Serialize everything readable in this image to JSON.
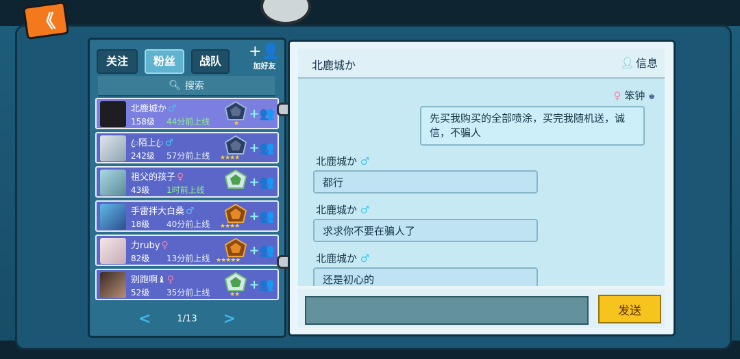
{
  "nav": {
    "back_symbol": "《"
  },
  "tabs": [
    {
      "label": "关注"
    },
    {
      "label": "粉丝"
    },
    {
      "label": "战队"
    }
  ],
  "add_friend": {
    "label": "加好友"
  },
  "search": {
    "placeholder": "搜索"
  },
  "friends": [
    {
      "name": "北鹿城か",
      "gender": "♂",
      "level": "158级",
      "online": "44分前上线",
      "stars": "★"
    },
    {
      "name": "ꦿ陌上ꦿ",
      "gender": "♂",
      "level": "242级",
      "online": "57分前上线",
      "stars": "★★★★"
    },
    {
      "name": "祖父的孩子",
      "gender": "♀",
      "level": "43级",
      "online": "1时前上线",
      "stars": ""
    },
    {
      "name": "手雷拌大白桑",
      "gender": "♂",
      "level": "18级",
      "online": "40分前上线",
      "stars": "★★★★"
    },
    {
      "name": "力ruby",
      "gender": "♀",
      "level": "82级",
      "online": "13分前上线",
      "stars": "★★★★★"
    },
    {
      "name": "别跑啊♝",
      "gender": "♀",
      "level": "52级",
      "online": "35分前上线",
      "stars": "★★"
    }
  ],
  "pager": {
    "text": "1/13"
  },
  "chat": {
    "title": "北鹿城か",
    "info_label": "信息",
    "messages": [
      {
        "sender": "笨钟",
        "gender": "♀",
        "text": "先买我购买的全部喷涂，买完我随机送，诚信，不骗人"
      },
      {
        "sender": "北鹿城か",
        "gender": "♂",
        "text": "都行"
      },
      {
        "sender": "北鹿城か",
        "gender": "♂",
        "text": "求求你不要在骗人了"
      },
      {
        "sender": "北鹿城か",
        "gender": "♂",
        "text": "还是初心的"
      }
    ],
    "send_label": "发送"
  }
}
